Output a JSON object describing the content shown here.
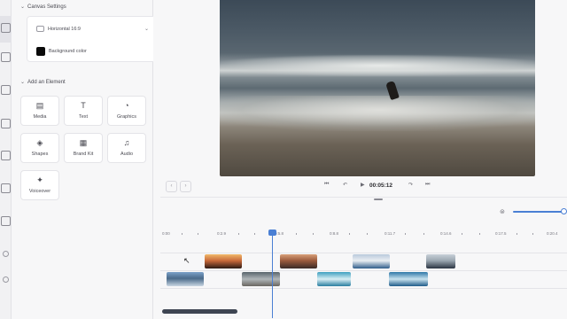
{
  "panel": {
    "canvas_settings": {
      "title": "Canvas Settings",
      "aspect_value": "Horizontal 16:9",
      "background_label": "Background color",
      "background_color": "#0a0a0a"
    },
    "add_element": {
      "title": "Add an Element",
      "tiles": [
        {
          "label": "Media",
          "icon": "media-icon",
          "glyph": "▤"
        },
        {
          "label": "Text",
          "icon": "text-icon",
          "glyph": "T"
        },
        {
          "label": "Graphics",
          "icon": "graphics-icon",
          "glyph": "◔"
        },
        {
          "label": "Shapes",
          "icon": "shapes-icon",
          "glyph": "◈"
        },
        {
          "label": "Brand Kit",
          "icon": "brand-kit-icon",
          "glyph": "▦"
        },
        {
          "label": "Audio",
          "icon": "audio-icon",
          "glyph": "♫"
        },
        {
          "label": "Voiceover",
          "icon": "voiceover-icon",
          "glyph": "✦"
        }
      ]
    }
  },
  "player": {
    "timecode": "00:05:12",
    "controls": [
      "skip-back",
      "step-back",
      "play",
      "step-forward",
      "skip-forward"
    ]
  },
  "timeline": {
    "ruler_labels": [
      "0:00",
      "0:2.9",
      "0:5.8",
      "0:8.8",
      "0:11.7",
      "0:14.6",
      "0:17.5",
      "0:20.4"
    ],
    "accent": "#4a7fd4"
  },
  "colors": {
    "accent": "#4a7fd4",
    "scrollbar": "#3e4552"
  }
}
